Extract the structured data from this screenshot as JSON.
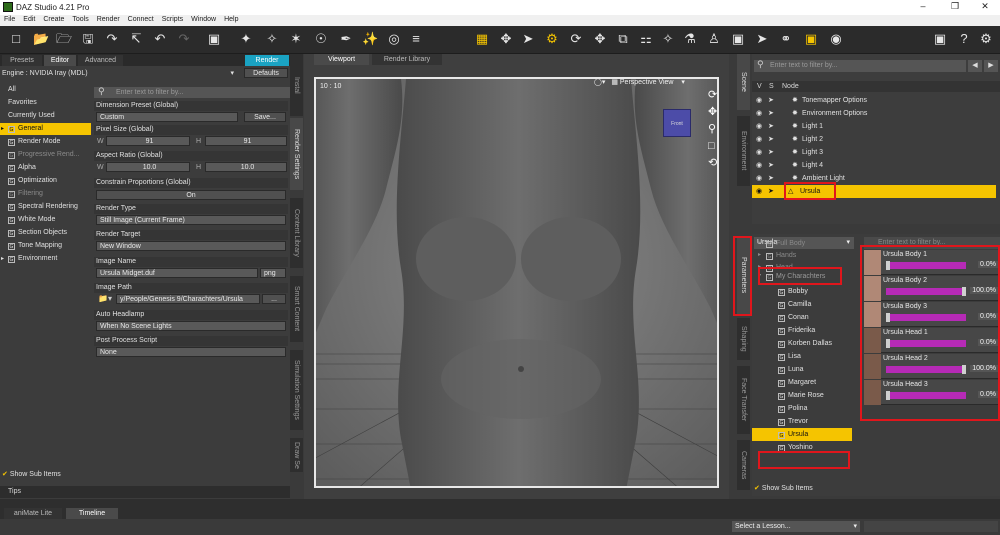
{
  "window": {
    "title": "DAZ Studio 4.21 Pro",
    "minimize": "–",
    "maximize": "❒",
    "close": "✕"
  },
  "menu": [
    "File",
    "Edit",
    "Create",
    "Tools",
    "Render",
    "Connect",
    "Scripts",
    "Window",
    "Help"
  ],
  "left": {
    "tabs": [
      "Presets",
      "Editor",
      "Advanced"
    ],
    "render_button": "Render",
    "engine_label": "Engine :",
    "engine_value": "NVIDIA Iray (MDL)",
    "defaults_button": "Defaults",
    "filter_placeholder": "Enter text to filter by...",
    "categories": [
      {
        "label": "All",
        "box": false,
        "selected": false,
        "dim": false
      },
      {
        "label": "Favorites",
        "box": false,
        "selected": false,
        "dim": false
      },
      {
        "label": "Currently Used",
        "box": false,
        "selected": false,
        "dim": false
      },
      {
        "label": "General",
        "box": true,
        "selected": true,
        "dim": false
      },
      {
        "label": "Render Mode",
        "box": true,
        "selected": false,
        "dim": false
      },
      {
        "label": "Progressive Rend...",
        "box": true,
        "selected": false,
        "dim": true
      },
      {
        "label": "Alpha",
        "box": true,
        "selected": false,
        "dim": false
      },
      {
        "label": "Optimization",
        "box": true,
        "selected": false,
        "dim": false
      },
      {
        "label": "Filtering",
        "box": true,
        "selected": false,
        "dim": true
      },
      {
        "label": "Spectral Rendering",
        "box": true,
        "selected": false,
        "dim": false
      },
      {
        "label": "White Mode",
        "box": true,
        "selected": false,
        "dim": false
      },
      {
        "label": "Section Objects",
        "box": true,
        "selected": false,
        "dim": false
      },
      {
        "label": "Tone Mapping",
        "box": true,
        "selected": false,
        "dim": false
      },
      {
        "label": "Environment",
        "box": true,
        "selected": false,
        "dim": false
      }
    ],
    "props": {
      "dimension_preset_label": "Dimension Preset (Global)",
      "dimension_preset_value": "Custom",
      "save_button": "Save...",
      "pixel_size_label": "Pixel Size (Global)",
      "w_label": "W",
      "h_label": "H",
      "pixel_w": "91",
      "pixel_h": "91",
      "aspect_label": "Aspect Ratio (Global)",
      "aspect_w": "10.0",
      "aspect_h": "10.0",
      "constrain_label": "Constrain Proportions (Global)",
      "constrain_value": "On",
      "render_type_label": "Render Type",
      "render_type_value": "Still Image (Current Frame)",
      "render_target_label": "Render Target",
      "render_target_value": "New Window",
      "image_name_label": "Image Name",
      "image_name_value": "Ursula Midget.duf",
      "image_ext": "png",
      "image_path_label": "Image Path",
      "image_path_value": "y/People/Genesis 9/Charachters/Ursula",
      "browse_button": "...",
      "headlamp_label": "Auto Headlamp",
      "headlamp_value": "When No Scene Lights",
      "post_script_label": "Post Process Script",
      "post_script_value": "None"
    },
    "show_sub_items": "Show Sub Items",
    "tips": "Tips",
    "side_tabs": [
      "Render Settings",
      "Content Library",
      "Smart Content",
      "Simulation Settings",
      "Draw Se"
    ],
    "install_tab": "Instal"
  },
  "viewport": {
    "tabs": [
      "Viewport",
      "Render Library"
    ],
    "aspect": "10 : 10",
    "camera": "Perspective View",
    "cube_label": "Front"
  },
  "scene": {
    "filter_placeholder": "Enter text to filter by...",
    "header_v": "V",
    "header_s": "S",
    "header_node": "Node",
    "nodes": [
      "Tonemapper Options",
      "Environment Options",
      "Light 1",
      "Light 2",
      "Light 3",
      "Light 4",
      "Ambient Light",
      "Ursula"
    ],
    "selected_node": "Ursula",
    "side_tabs": [
      "Scene",
      "Environment"
    ]
  },
  "params": {
    "figure": "Ursula",
    "filter_placeholder": "Enter text to filter by...",
    "tree_top": [
      "Full Body",
      "Hands",
      "Head",
      "My Charachters"
    ],
    "tree_items": [
      "Bobby",
      "Camilla",
      "Conan",
      "Friderika",
      "Korben Dallas",
      "Lisa",
      "Luna",
      "Margaret",
      "Marie Rose",
      "Polina",
      "Trevor",
      "Ursula",
      "Yoshino"
    ],
    "selected_item": "Ursula",
    "show_sub_items": "Show Sub Items",
    "side_tabs": [
      "Parameters",
      "Shaping",
      "Face Transfer",
      "Cameras"
    ],
    "morphs": [
      {
        "name": "Ursula Body 1",
        "value": "0.0%",
        "fill": 0
      },
      {
        "name": "Ursula Body 2",
        "value": "100.0%",
        "fill": 1
      },
      {
        "name": "Ursula Body 3",
        "value": "0.0%",
        "fill": 0
      },
      {
        "name": "Ursula Head 1",
        "value": "0.0%",
        "fill": 0
      },
      {
        "name": "Ursula Head 2",
        "value": "100.0%",
        "fill": 1
      },
      {
        "name": "Ursula Head 3",
        "value": "0.0%",
        "fill": 0
      }
    ]
  },
  "bottom": {
    "tabs": [
      "aniMate Lite",
      "Timeline"
    ],
    "lesson": "Select a Lesson..."
  },
  "colors": {
    "accent": "#f5c400",
    "highlight_box": "#e0161c",
    "morph_bar": "#b62ab6"
  }
}
